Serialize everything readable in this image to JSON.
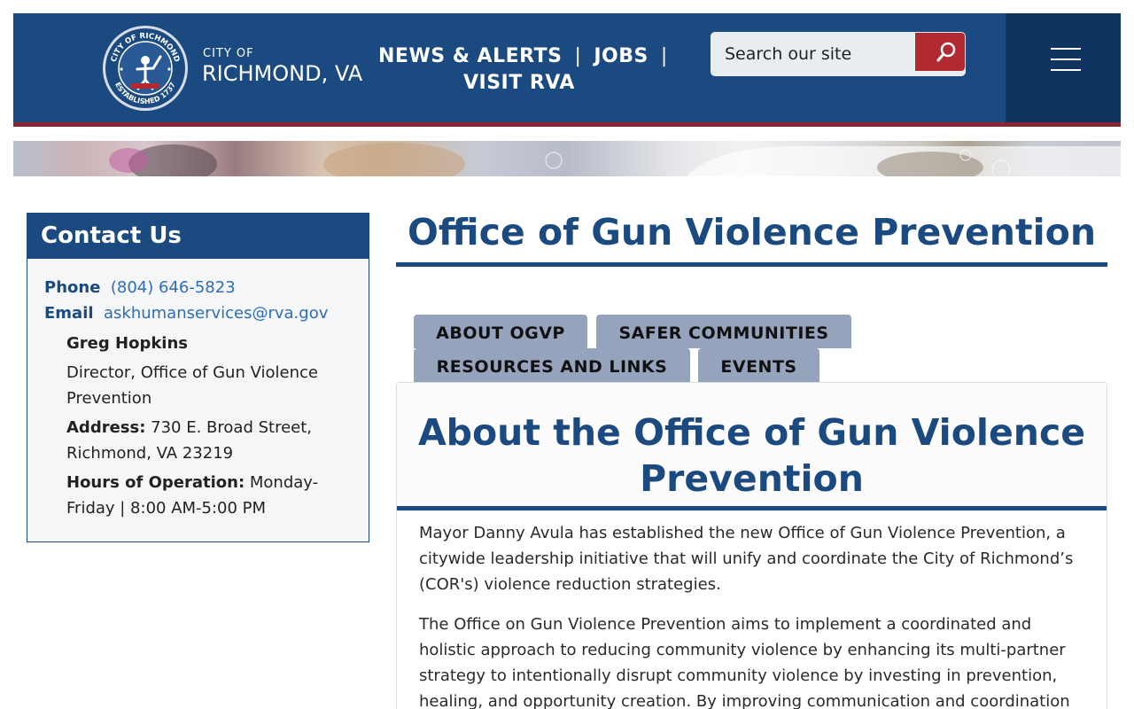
{
  "header": {
    "city_of": "CITY OF",
    "city_name": "RICHMOND, VA",
    "seal": {
      "text_top": "CITY OF RICHMOND",
      "text_bottom": "ESTABLISHED 1737"
    },
    "nav": [
      {
        "label": "NEWS & ALERTS"
      },
      {
        "label": "JOBS"
      },
      {
        "label": "VISIT RVA"
      }
    ],
    "search": {
      "placeholder": "Search our site"
    },
    "colors": {
      "header_blue": "#1b4a80",
      "menu_block": "#0f3460",
      "rule_red": "#8a2630",
      "search_button": "#b02a30"
    }
  },
  "contact": {
    "heading": "Contact Us",
    "phone_label": "Phone",
    "phone": "(804) 646-5823",
    "email_label": "Email",
    "email": "askhumanservices@rva.gov",
    "name": "Greg Hopkins",
    "title": "Director, Office of Gun Violence Prevention",
    "address_label": "Address:",
    "address": "730 E. Broad Street, Richmond, VA 23219",
    "hours_label": "Hours of Operation:",
    "hours": "Monday-Friday | 8:00 AM-5:00 PM"
  },
  "main": {
    "page_title": "Office of Gun Violence Prevention",
    "tabs": [
      {
        "label": "ABOUT OGVP"
      },
      {
        "label": "SAFER COMMUNITIES"
      },
      {
        "label": "RESOURCES AND LINKS"
      },
      {
        "label": "EVENTS"
      }
    ],
    "panel_title": "About the Office of Gun Violence Prevention",
    "paragraphs": [
      "Mayor Danny Avula has established the new Office of Gun Violence Prevention, a citywide leadership initiative that will unify and coordinate the City of Richmond’s (COR's) violence reduction strategies.",
      "The Office on Gun Violence Prevention aims to implement a coordinated and holistic approach to reducing community violence by enhancing its multi-partner strategy to intentionally disrupt community violence by investing in prevention, healing, and opportunity creation. By improving communication and coordination"
    ]
  }
}
